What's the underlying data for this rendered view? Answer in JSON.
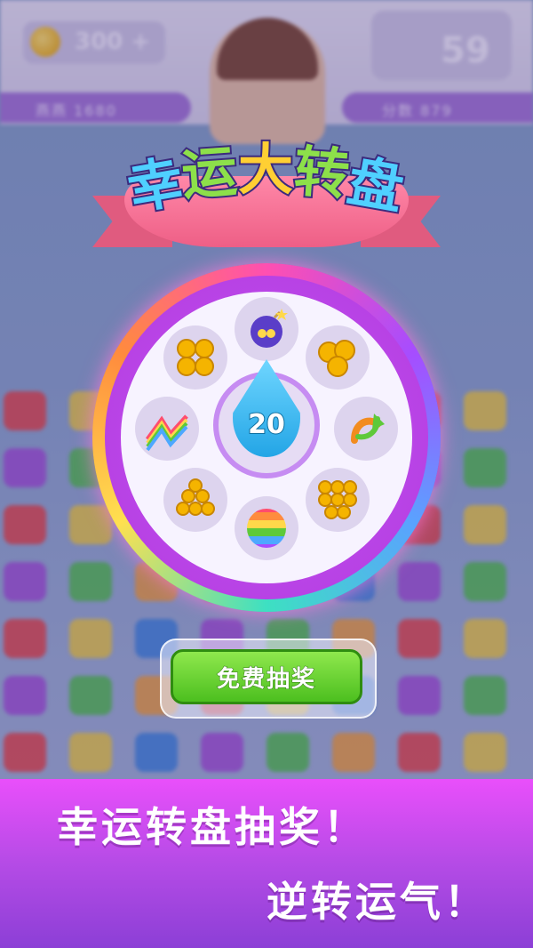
{
  "hud": {
    "coins": "300",
    "coins_plus": "+",
    "timer_value": "59",
    "left_strip": "燕燕 1680",
    "right_strip": "分数 879"
  },
  "wheel_title": {
    "chars": [
      "幸",
      "运",
      "大",
      "转",
      "盘"
    ]
  },
  "wheel": {
    "center_value": "20",
    "slots": [
      {
        "item": "bomb-icon"
      },
      {
        "item": "gold-coins-icon"
      },
      {
        "item": "swap-arrows-icon"
      },
      {
        "item": "gold-coins-pile-icon"
      },
      {
        "item": "rainbow-ball-icon"
      },
      {
        "item": "gold-coins-pile-icon"
      },
      {
        "item": "rainbow-lightning-icon"
      },
      {
        "item": "gold-coins-icon"
      }
    ]
  },
  "actions": {
    "free_spin_label": "免费抽奖"
  },
  "promo": {
    "line1": "幸运转盘抽奖！",
    "line2": "逆转运气！"
  },
  "colors": {
    "accent": "#c94ff0",
    "button": "#4cbf1f",
    "promo": "#e94ffb"
  }
}
